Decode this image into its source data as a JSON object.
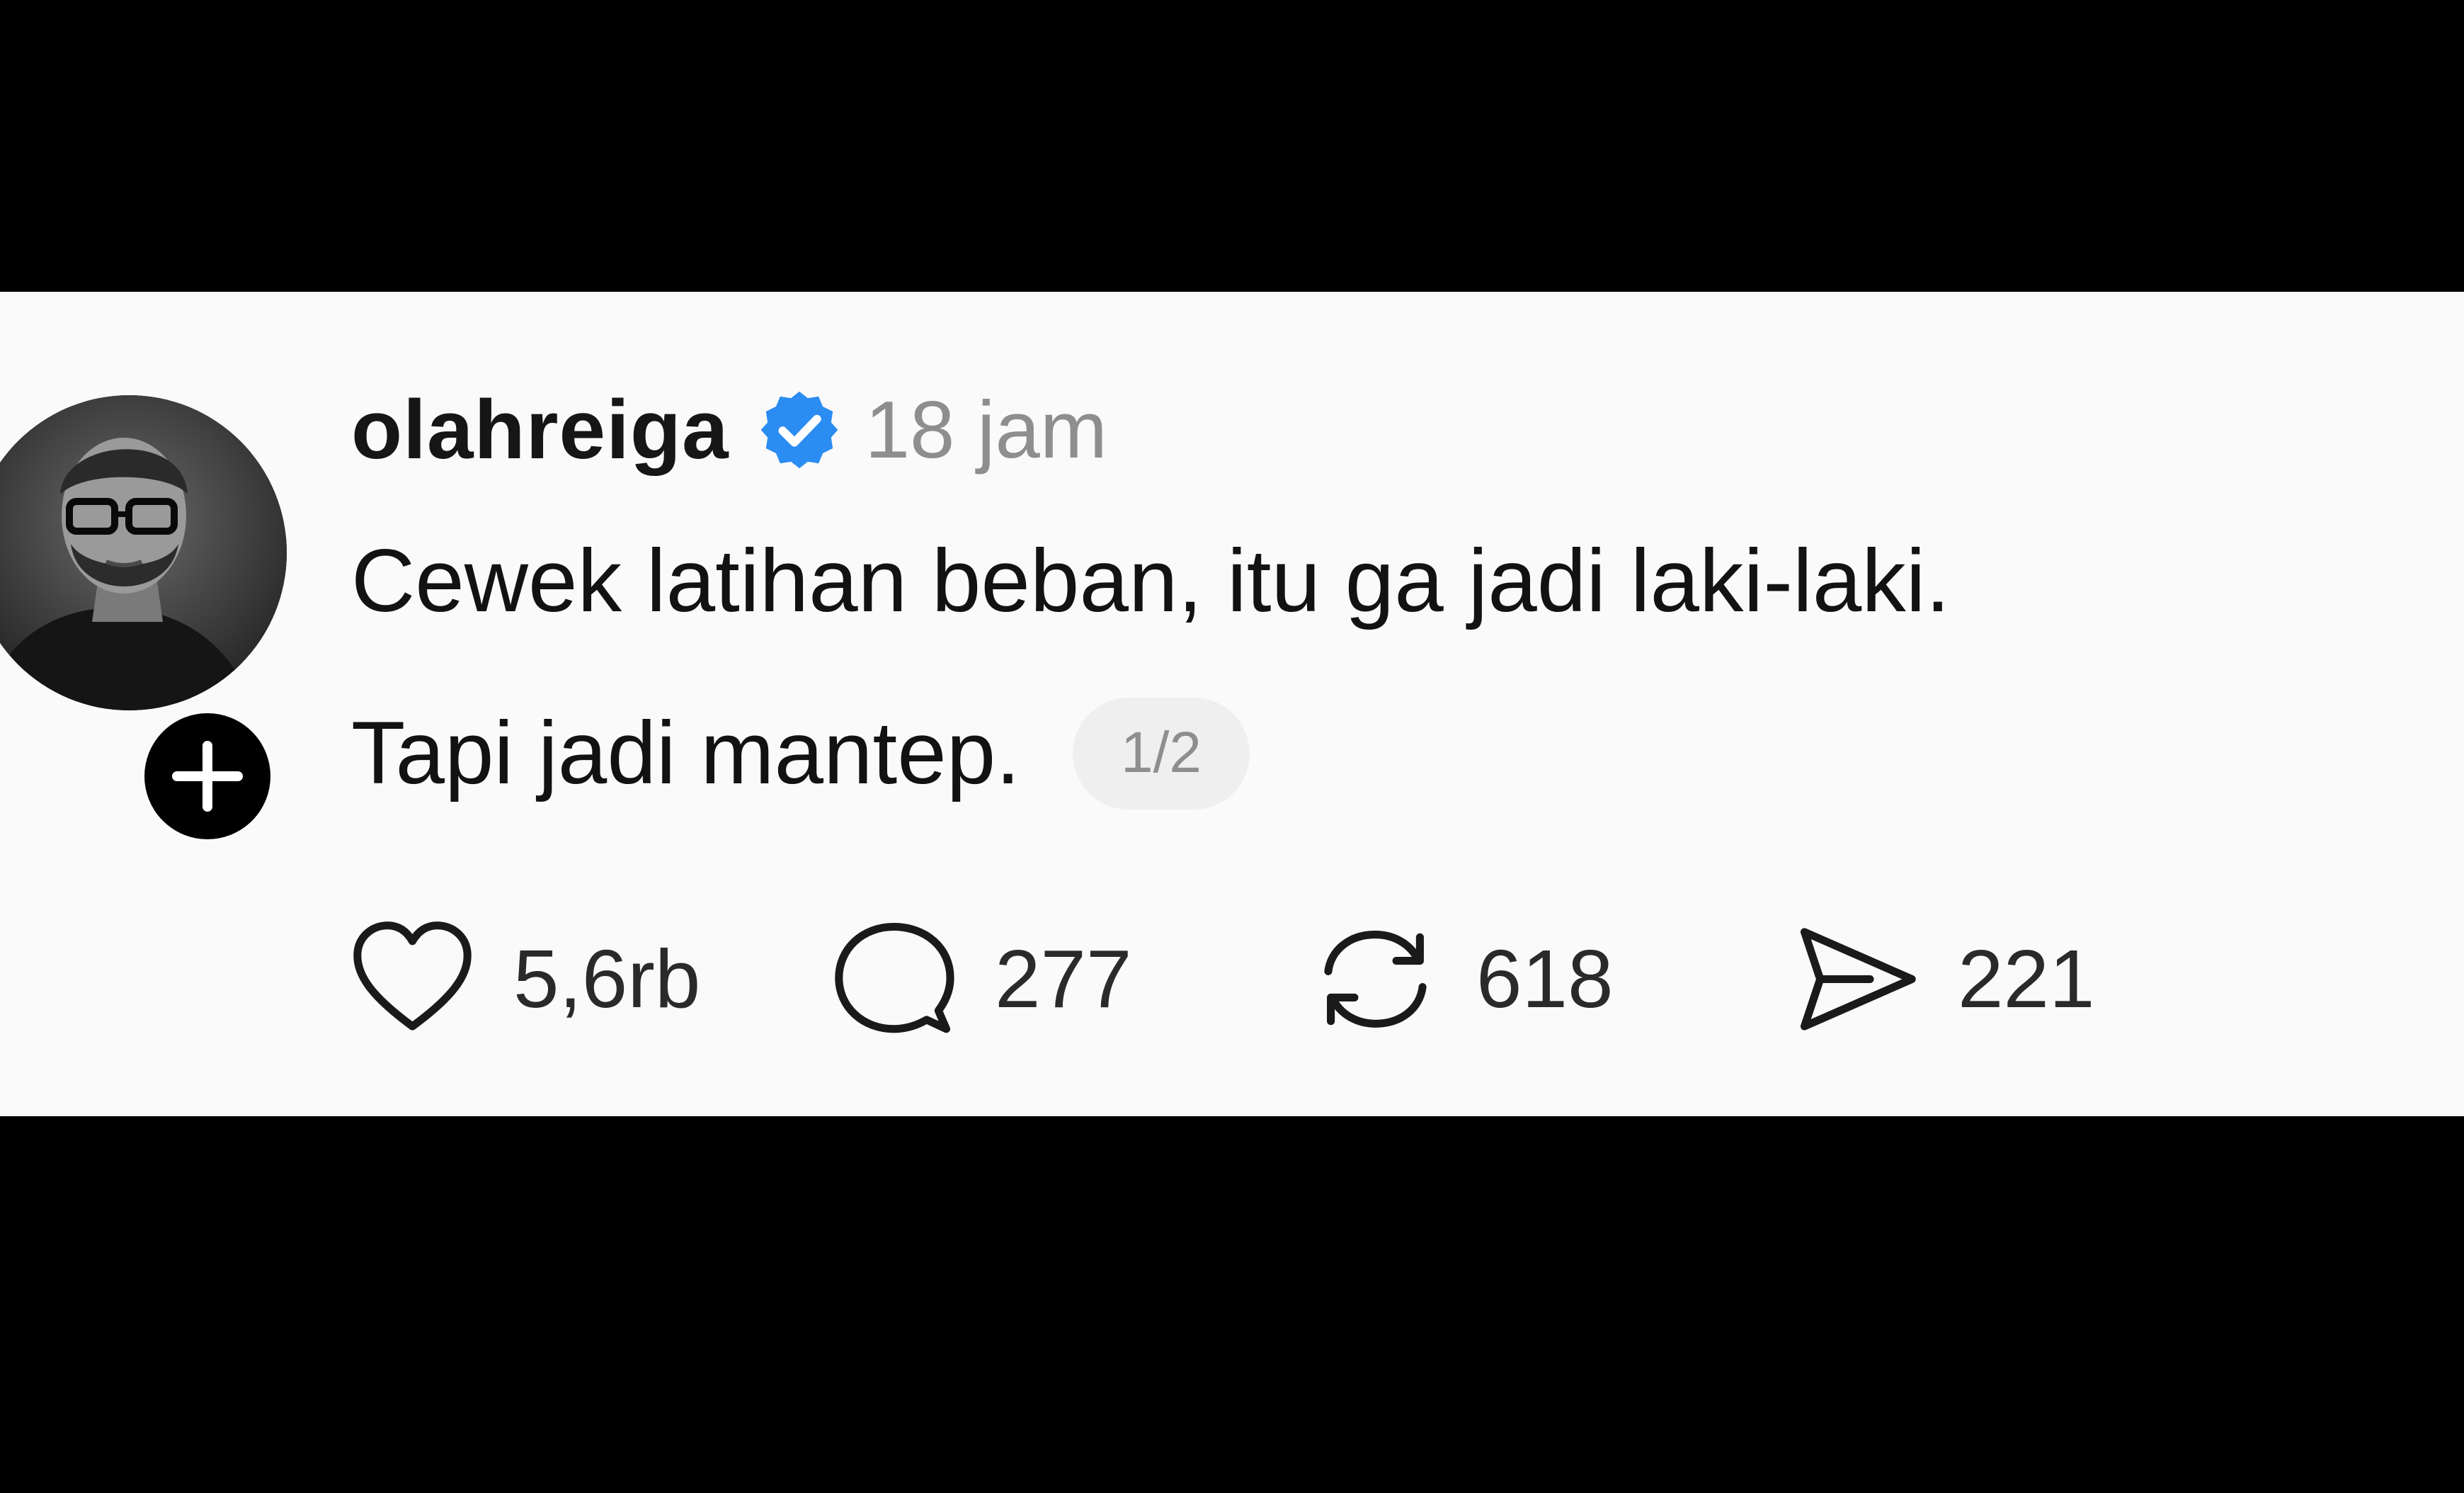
{
  "post": {
    "username": "olahreiga",
    "verified": true,
    "timestamp": "18 jam",
    "text_line1": "Cewek latihan beban, itu ga jadi laki-laki.",
    "text_line2": "Tapi jadi mantep.",
    "page_indicator": "1/2"
  },
  "actions": {
    "likes": "5,6rb",
    "replies": "277",
    "reposts": "618",
    "shares": "221"
  },
  "icons": {
    "avatar": "profile-photo",
    "follow": "plus-icon",
    "verified": "verified-badge-icon",
    "like": "heart-icon",
    "reply": "speech-bubble-icon",
    "repost": "repost-icon",
    "share": "send-icon"
  },
  "colors": {
    "background": "#000000",
    "card": "#fafafa",
    "verified": "#2b8cf2",
    "muted": "#8e8e8e",
    "text": "#121212"
  }
}
